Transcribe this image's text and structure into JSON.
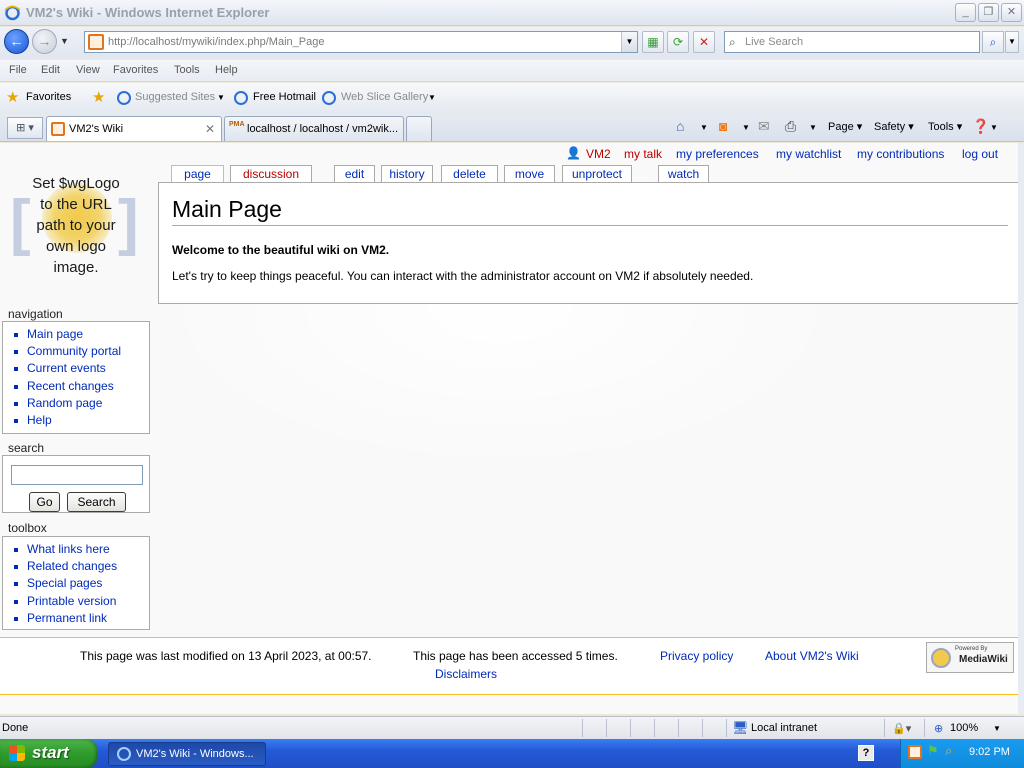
{
  "window": {
    "title": "VM2's Wiki - Windows Internet Explorer",
    "address_host": "http://localhost",
    "address_path": "/mywiki/index.php/Main_Page",
    "search_placeholder": "Live Search"
  },
  "menu": [
    "File",
    "Edit",
    "View",
    "Favorites",
    "Tools",
    "Help"
  ],
  "favorites_bar": {
    "favorites_label": "Favorites",
    "suggested": "Suggested Sites",
    "hotmail": "Free Hotmail",
    "slice": "Web Slice Gallery"
  },
  "tabs": [
    {
      "label": "VM2's Wiki"
    },
    {
      "label": "localhost / localhost / vm2wik..."
    }
  ],
  "pma_badge": "PMA",
  "commands": {
    "page": "Page",
    "safety": "Safety",
    "tools": "Tools"
  },
  "wiki": {
    "logo_text": [
      "Set $wgLogo",
      "to the URL",
      "path to your",
      "own logo",
      "image."
    ],
    "personal": {
      "user": "VM2",
      "talk": "my talk",
      "preferences": "my preferences",
      "watchlist": "my watchlist",
      "contributions": "my contributions",
      "logout": "log out"
    },
    "page_tabs": {
      "page": "page",
      "discussion": "discussion",
      "edit": "edit",
      "history": "history",
      "delete": "delete",
      "move": "move",
      "unprotect": "unprotect",
      "watch": "watch"
    },
    "title": "Main Page",
    "welcome": "Welcome to the beautiful wiki on VM2.",
    "paragraph": "Let's try to keep things peaceful. You can interact with the administrator account on VM2 if absolutely needed.",
    "navigation": {
      "heading": "navigation",
      "items": [
        "Main page",
        "Community portal",
        "Current events",
        "Recent changes",
        "Random page",
        "Help"
      ]
    },
    "search": {
      "heading": "search",
      "go": "Go",
      "search": "Search"
    },
    "toolbox": {
      "heading": "toolbox",
      "items": [
        "What links here",
        "Related changes",
        "Special pages",
        "Printable version",
        "Permanent link"
      ]
    },
    "footer": {
      "lastmod": "This page was last modified on 13 April 2023, at 00:57.",
      "accessed": "This page has been accessed 5 times.",
      "privacy": "Privacy policy",
      "about": "About VM2's Wiki",
      "disclaimers": "Disclaimers",
      "powered_by": "Powered By",
      "mediawiki": "MediaWiki"
    }
  },
  "statusbar": {
    "status": "Done",
    "zone": "Local intranet",
    "zoom": "100%"
  },
  "taskbar": {
    "start": "start",
    "task": "VM2's Wiki - Windows...",
    "clock": "9:02 PM"
  }
}
